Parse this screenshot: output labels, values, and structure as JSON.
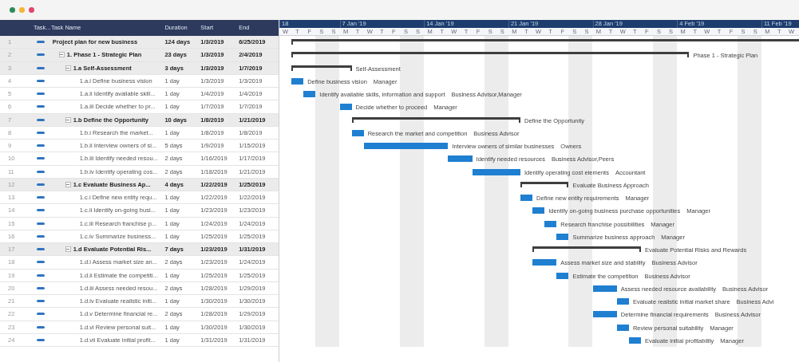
{
  "window_buttons": [
    {
      "color": "#2e8b57"
    },
    {
      "color": "#f2b632"
    },
    {
      "color": "#e0456b"
    }
  ],
  "columns": [
    "Task...",
    "Task Name",
    "Duration",
    "Start",
    "End"
  ],
  "weeks": [
    {
      "label": "18",
      "days": [
        {
          "letter": "W",
          "weekend": false
        },
        {
          "letter": "T",
          "weekend": false
        },
        {
          "letter": "F",
          "weekend": false
        },
        {
          "letter": "S",
          "weekend": true
        },
        {
          "letter": "S",
          "weekend": true
        }
      ]
    },
    {
      "label": "7 Jan '19",
      "days": [
        {
          "letter": "M",
          "weekend": false
        },
        {
          "letter": "T",
          "weekend": false
        },
        {
          "letter": "W",
          "weekend": false
        },
        {
          "letter": "T",
          "weekend": false
        },
        {
          "letter": "F",
          "weekend": false
        },
        {
          "letter": "S",
          "weekend": true
        },
        {
          "letter": "S",
          "weekend": true
        }
      ]
    },
    {
      "label": "14 Jan '19",
      "days": [
        {
          "letter": "M",
          "weekend": false
        },
        {
          "letter": "T",
          "weekend": false
        },
        {
          "letter": "W",
          "weekend": false
        },
        {
          "letter": "T",
          "weekend": false
        },
        {
          "letter": "F",
          "weekend": false
        },
        {
          "letter": "S",
          "weekend": true
        },
        {
          "letter": "S",
          "weekend": true
        }
      ]
    },
    {
      "label": "21 Jan '19",
      "days": [
        {
          "letter": "M",
          "weekend": false
        },
        {
          "letter": "T",
          "weekend": false
        },
        {
          "letter": "W",
          "weekend": false
        },
        {
          "letter": "T",
          "weekend": false
        },
        {
          "letter": "F",
          "weekend": false
        },
        {
          "letter": "S",
          "weekend": true
        },
        {
          "letter": "S",
          "weekend": true
        }
      ]
    },
    {
      "label": "28 Jan '19",
      "days": [
        {
          "letter": "M",
          "weekend": false
        },
        {
          "letter": "T",
          "weekend": false
        },
        {
          "letter": "W",
          "weekend": false
        },
        {
          "letter": "T",
          "weekend": false
        },
        {
          "letter": "F",
          "weekend": false
        },
        {
          "letter": "S",
          "weekend": true
        },
        {
          "letter": "S",
          "weekend": true
        }
      ]
    },
    {
      "label": "4 Feb '19",
      "days": [
        {
          "letter": "M",
          "weekend": false
        },
        {
          "letter": "T",
          "weekend": false
        },
        {
          "letter": "W",
          "weekend": false
        },
        {
          "letter": "T",
          "weekend": false
        },
        {
          "letter": "F",
          "weekend": false
        },
        {
          "letter": "S",
          "weekend": true
        },
        {
          "letter": "S",
          "weekend": true
        }
      ]
    },
    {
      "label": "11 Feb '19",
      "days": [
        {
          "letter": "M",
          "weekend": false
        },
        {
          "letter": "T",
          "weekend": false
        },
        {
          "letter": "W",
          "weekend": false
        }
      ]
    }
  ],
  "tasks": [
    {
      "row_number": "1",
      "kind": "summary",
      "name": "Project plan for new business",
      "duration": "124 days",
      "start": "1/3/2019",
      "end": "6/25/2019",
      "children": [
        {
          "row_number": "2",
          "kind": "summary",
          "expanded": true,
          "name": "1. Phase 1 - Strategic Plan",
          "duration": "23 days",
          "start": "1/3/2019",
          "end": "2/4/2019",
          "bar_label": "Phase 1 - Strategic Plan",
          "children": [
            {
              "row_number": "3",
              "kind": "summary",
              "expanded": true,
              "name": "1.a Self-Assessment",
              "duration": "3 days",
              "start": "1/3/2019",
              "end": "1/7/2019",
              "bar_label": "Self-Assessment",
              "children": [
                {
                  "row_number": "4",
                  "kind": "task",
                  "name": "1.a.i Define business vision",
                  "duration": "1 day",
                  "start": "1/3/2019",
                  "end": "1/3/2019",
                  "bar_label": "Define business vision",
                  "resource": "Manager"
                },
                {
                  "row_number": "5",
                  "kind": "task",
                  "name": "1.a.ii Identify available skill...",
                  "duration": "1 day",
                  "start": "1/4/2019",
                  "end": "1/4/2019",
                  "bar_label": "Identify available skills, information and support",
                  "resource": "Business Advisor,Manager"
                },
                {
                  "row_number": "6",
                  "kind": "task",
                  "name": "1.a.iii Decide whether to pr...",
                  "duration": "1 day",
                  "start": "1/7/2019",
                  "end": "1/7/2019",
                  "bar_label": "Decide whether to proceed",
                  "resource": "Manager"
                }
              ]
            },
            {
              "row_number": "7",
              "kind": "summary",
              "expanded": true,
              "name": "1.b Define the Opportunity",
              "duration": "10 days",
              "start": "1/8/2019",
              "end": "1/21/2019",
              "bar_label": "Define the Opportunity",
              "children": [
                {
                  "row_number": "8",
                  "kind": "task",
                  "name": "1.b.i Research the market...",
                  "duration": "1 day",
                  "start": "1/8/2019",
                  "end": "1/8/2019",
                  "bar_label": "Research the market and competition",
                  "resource": "Business Advisor"
                },
                {
                  "row_number": "9",
                  "kind": "task",
                  "name": "1.b.ii Interview owners of si...",
                  "duration": "5 days",
                  "start": "1/9/2019",
                  "end": "1/15/2019",
                  "bar_label": "Interview owners of similar businesses",
                  "resource": "Owners"
                },
                {
                  "row_number": "10",
                  "kind": "task",
                  "name": "1.b.iii Identify needed resou...",
                  "duration": "2 days",
                  "start": "1/16/2019",
                  "end": "1/17/2019",
                  "bar_label": "Identify needed resources",
                  "resource": "Business Advisor,Peers"
                },
                {
                  "row_number": "11",
                  "kind": "task",
                  "name": "1.b.iv Identify operating cos...",
                  "duration": "2 days",
                  "start": "1/18/2019",
                  "end": "1/21/2019",
                  "bar_label": "Identify operating cost elements",
                  "resource": "Accountant"
                }
              ]
            },
            {
              "row_number": "12",
              "kind": "summary",
              "expanded": true,
              "name": "1.c Evaluate Business Ap...",
              "duration": "4 days",
              "start": "1/22/2019",
              "end": "1/25/2019",
              "bar_label": "Evaluate Business Approach",
              "children": [
                {
                  "row_number": "13",
                  "kind": "task",
                  "name": "1.c.i Define new entity requ...",
                  "duration": "1 day",
                  "start": "1/22/2019",
                  "end": "1/22/2019",
                  "bar_label": "Define new entity requirements",
                  "resource": "Manager"
                },
                {
                  "row_number": "14",
                  "kind": "task",
                  "name": "1.c.ii Identify on-going busi...",
                  "duration": "1 day",
                  "start": "1/23/2019",
                  "end": "1/23/2019",
                  "bar_label": "Identify on-going business purchase opportunities",
                  "resource": "Manager"
                },
                {
                  "row_number": "15",
                  "kind": "task",
                  "name": "1.c.iii Research franchise p...",
                  "duration": "1 day",
                  "start": "1/24/2019",
                  "end": "1/24/2019",
                  "bar_label": "Research franchise possibilities",
                  "resource": "Manager"
                },
                {
                  "row_number": "16",
                  "kind": "task",
                  "name": "1.c.iv Summarize business...",
                  "duration": "1 day",
                  "start": "1/25/2019",
                  "end": "1/25/2019",
                  "bar_label": "Summarize business approach",
                  "resource": "Manager"
                }
              ]
            },
            {
              "row_number": "17",
              "kind": "summary",
              "expanded": true,
              "name": "1.d Evaluate Potential Ris...",
              "duration": "7 days",
              "start": "1/23/2019",
              "end": "1/31/2019",
              "bar_label": "Evaluate Potential Risks and Rewards",
              "children": [
                {
                  "row_number": "18",
                  "kind": "task",
                  "name": "1.d.i Assess market size an...",
                  "duration": "2 days",
                  "start": "1/23/2019",
                  "end": "1/24/2019",
                  "bar_label": "Assess market size and stability",
                  "resource": "Business Advisor"
                },
                {
                  "row_number": "19",
                  "kind": "task",
                  "name": "1.d.ii Estimate the competiti...",
                  "duration": "1 day",
                  "start": "1/25/2019",
                  "end": "1/25/2019",
                  "bar_label": "Estimate the competition",
                  "resource": "Business Advisor"
                },
                {
                  "row_number": "20",
                  "kind": "task",
                  "name": "1.d.iii Assess needed resou...",
                  "duration": "2 days",
                  "start": "1/28/2019",
                  "end": "1/29/2019",
                  "bar_label": "Assess needed resource availability",
                  "resource": "Business Advisor"
                },
                {
                  "row_number": "21",
                  "kind": "task",
                  "name": "1.d.iv Evaluate realistic initi...",
                  "duration": "1 day",
                  "start": "1/30/2019",
                  "end": "1/30/2019",
                  "bar_label": "Evaluate realistic initial market share",
                  "resource": "Business Advi"
                },
                {
                  "row_number": "22",
                  "kind": "task",
                  "name": "1.d.v Determine financial re...",
                  "duration": "2 days",
                  "start": "1/28/2019",
                  "end": "1/29/2019",
                  "bar_label": "Determine financial requirements",
                  "resource": "Business Advisor"
                },
                {
                  "row_number": "23",
                  "kind": "task",
                  "name": "1.d.vi Review personal suit...",
                  "duration": "1 day",
                  "start": "1/30/2019",
                  "end": "1/30/2019",
                  "bar_label": "Review personal suitability",
                  "resource": "Manager"
                },
                {
                  "row_number": "24",
                  "kind": "task",
                  "name": "1.d.vii Evaluate initial profit...",
                  "duration": "1 day",
                  "start": "1/31/2019",
                  "end": "1/31/2019",
                  "bar_label": "Evaluate initial profitability",
                  "resource": "Manager"
                }
              ]
            }
          ]
        }
      ]
    }
  ]
}
